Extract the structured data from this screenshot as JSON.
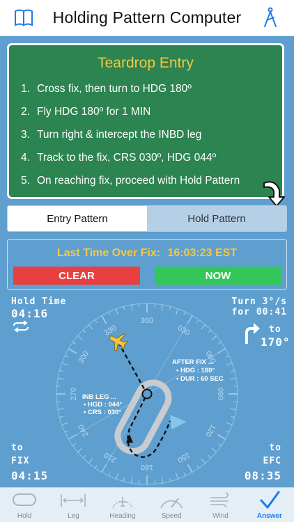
{
  "header": {
    "title": "Holding Pattern Computer"
  },
  "instructions": {
    "title": "Teardrop Entry",
    "steps": [
      {
        "num": "1.",
        "text": "Cross fix, then turn to HDG 180º"
      },
      {
        "num": "2.",
        "text": "Fly HDG 180º for 1 MIN"
      },
      {
        "num": "3.",
        "text": "Turn right & intercept the INBD leg"
      },
      {
        "num": "4.",
        "text": "Track to the fix, CRS 030º, HDG 044º"
      },
      {
        "num": "5.",
        "text": "On reaching fix, proceed with Hold Pattern"
      }
    ]
  },
  "segment": {
    "entry_label": "Entry Pattern",
    "hold_label": "Hold Pattern",
    "selected": "Entry Pattern"
  },
  "time_panel": {
    "label": "Last Time Over Fix:",
    "time": "16:03:23 EST",
    "clear_label": "CLEAR",
    "now_label": "NOW"
  },
  "hold_time": {
    "label": "Hold Time",
    "value": "04:16"
  },
  "turn": {
    "rate_label": "Turn 3°/s",
    "for_label": "for 00:41",
    "to_label": "to",
    "heading": "170°"
  },
  "to_fix": {
    "to_label": "to",
    "fix_label": "FIX",
    "value": "04:15"
  },
  "to_efc": {
    "to_label": "to",
    "efc_label": "EFC",
    "value": "08:35"
  },
  "after_fix": {
    "title": "AFTER FIX ...",
    "hdg": "• HDG : 180°",
    "dur": "• DUR : 60 SEC"
  },
  "inb_leg": {
    "title": "INB LEG ...",
    "hgd": "• HGD : 044°",
    "crs": "• CRS : 030°"
  },
  "compass_labels": [
    "360",
    "030",
    "060",
    "090",
    "120",
    "150",
    "180",
    "210",
    "240",
    "270",
    "300",
    "330"
  ],
  "tabs": [
    {
      "label": "Hold",
      "icon": "hold-icon"
    },
    {
      "label": "Leg",
      "icon": "leg-icon"
    },
    {
      "label": "Heading",
      "icon": "heading-icon"
    },
    {
      "label": "Speed",
      "icon": "speed-icon"
    },
    {
      "label": "Wind",
      "icon": "wind-icon"
    },
    {
      "label": "Answer",
      "icon": "checkmark-icon",
      "active": true
    }
  ],
  "colors": {
    "background": "#5f9fcf",
    "instruction_panel": "#2c8450",
    "accent_yellow": "#f5c842",
    "clear_red": "#e84040",
    "now_green": "#33c659",
    "active_tab": "#1e7be8"
  }
}
